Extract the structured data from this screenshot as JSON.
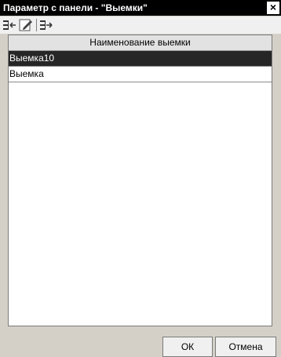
{
  "window": {
    "title": "Параметр с панели - \"Выемки\"",
    "close_glyph": "×"
  },
  "toolbar": {
    "buttons": [
      {
        "icon": "insert-row-icon"
      },
      {
        "icon": "edit-icon"
      },
      {
        "icon": "move-row-icon"
      }
    ]
  },
  "table": {
    "column_header": "Наименование выемки",
    "rows": [
      {
        "name": "Выемка10",
        "selected": true
      },
      {
        "name": "Выемка",
        "selected": false
      }
    ]
  },
  "footer": {
    "ok_label": "ОК",
    "cancel_label": "Отмена"
  }
}
